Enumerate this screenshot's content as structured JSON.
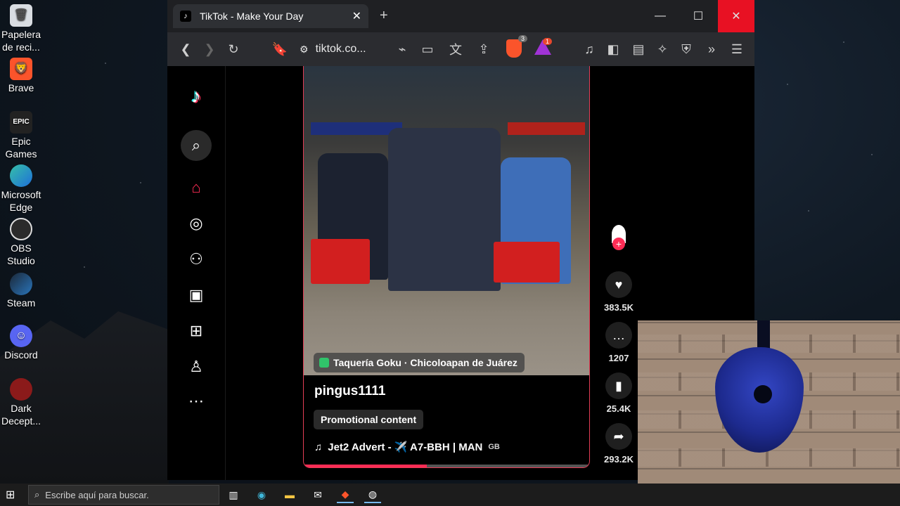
{
  "desktop": {
    "icons": [
      {
        "label": "Papelera de reci...",
        "icon": "recycle-bin-icon"
      },
      {
        "label": "Brave",
        "icon": "brave-icon"
      },
      {
        "label": "Epic Games ...",
        "icon": "epic-games-icon"
      },
      {
        "label": "Microsoft Edge",
        "icon": "edge-icon"
      },
      {
        "label": "OBS Studio",
        "icon": "obs-icon"
      },
      {
        "label": "Steam",
        "icon": "steam-icon"
      },
      {
        "label": "Discord",
        "icon": "discord-icon"
      },
      {
        "label": "Dark Decept...",
        "icon": "dark-deception-icon"
      }
    ]
  },
  "browser": {
    "tab_title": "TikTok - Make Your Day",
    "url": "tiktok.co...",
    "brave_shield_count": "3",
    "rewards_count": "1",
    "colors": {
      "close_button": "#e81123",
      "brave": "#fb542b"
    }
  },
  "tiktok": {
    "sidebar_icons": [
      "tiktok-logo-icon",
      "search-icon",
      "home-icon",
      "explore-icon",
      "following-icon",
      "live-icon",
      "upload-icon",
      "profile-icon",
      "more-icon"
    ],
    "video": {
      "location": "Taquería Goku · Chicoloapan de Juárez",
      "author": "pingus1111",
      "promo_label": "Promotional content",
      "music": "Jet2 Advert - ✈️ A7-BBH | MAN",
      "music_suffix": "GB",
      "progress_percent": 43
    },
    "actions": {
      "likes": "383.5K",
      "comments": "1207",
      "saves": "25.4K",
      "shares": "293.2K"
    },
    "accent": "#fe2c55"
  },
  "taskbar": {
    "search_placeholder": "Escribe aquí para buscar.",
    "apps": [
      "task-view-icon",
      "edge-icon",
      "file-explorer-icon",
      "mail-icon",
      "brave-icon",
      "obs-icon"
    ]
  }
}
